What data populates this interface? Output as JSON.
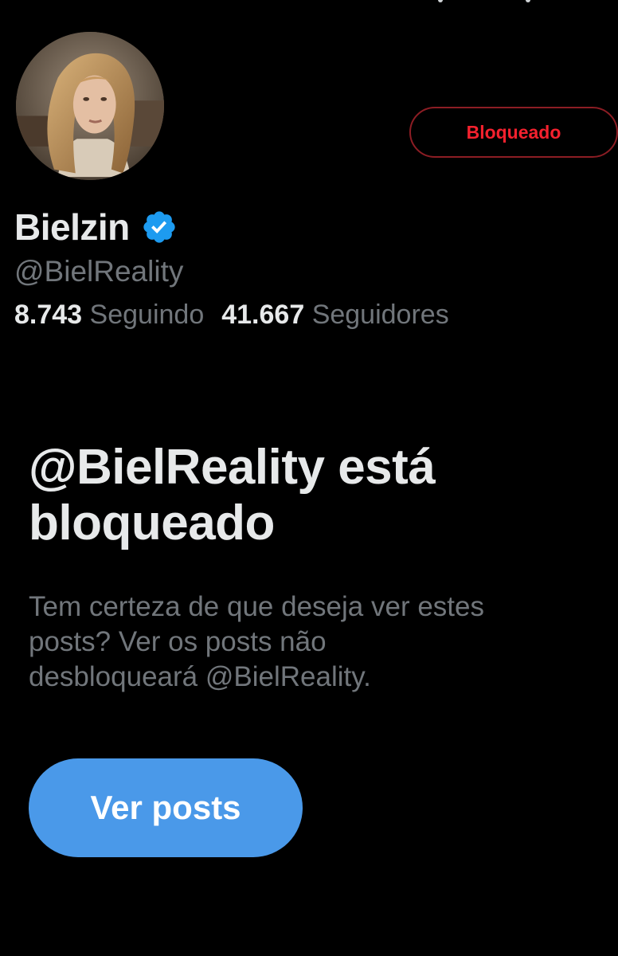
{
  "profile": {
    "display_name": "Bielzin",
    "handle": "@BielReality",
    "verified": true,
    "avatar": "profile-photo"
  },
  "actions": {
    "blocked_label": "Bloqueado",
    "view_posts_label": "Ver posts"
  },
  "stats": {
    "following_count": "8.743",
    "following_label": "Seguindo",
    "followers_count": "41.667",
    "followers_label": "Seguidores"
  },
  "blocked_notice": {
    "title_line1": "@BielReality está",
    "title_line2": "bloqueado",
    "description_line1": "Tem certeza de que deseja ver estes",
    "description_line2": "posts? Ver os posts não",
    "description_line3": "desbloqueará @BielReality."
  },
  "colors": {
    "background": "#000000",
    "text_primary": "#e7e9ea",
    "text_secondary": "#71767b",
    "blocked_red": "#f4212e",
    "blocked_border": "#8c1d24",
    "accent_blue": "#4a99e9",
    "verified_blue": "#1d9bf0"
  }
}
